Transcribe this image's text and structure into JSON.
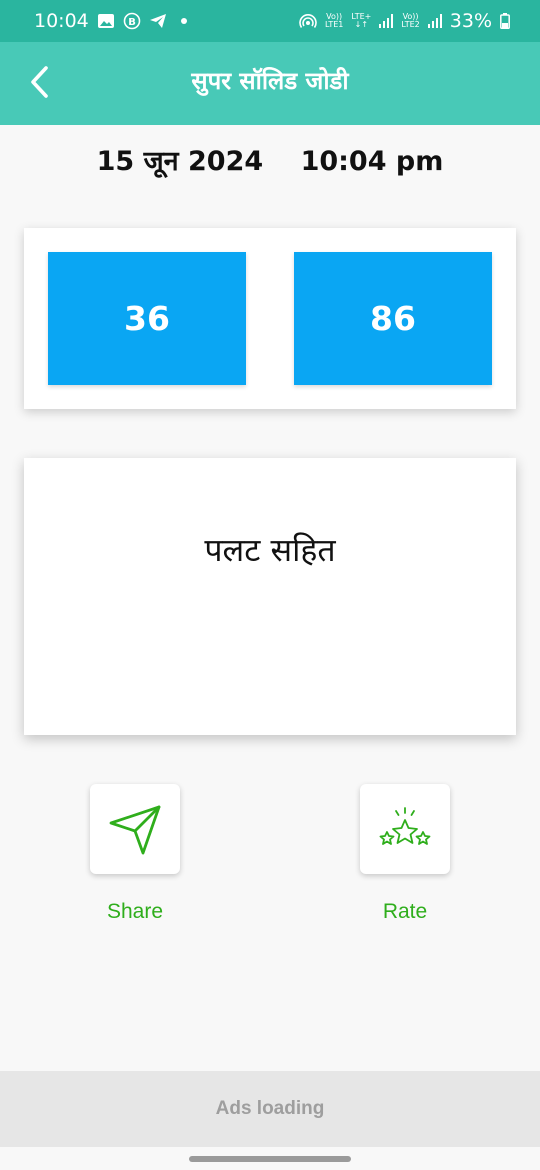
{
  "status_bar": {
    "time": "10:04",
    "left_icons": [
      "image-icon",
      "b-badge-icon",
      "telegram-icon",
      "dot-icon"
    ],
    "sim1_label": "LTE1",
    "sim2_label": "LTE2",
    "lte_plus": "LTE+",
    "volte": "Vo))",
    "battery": "33%"
  },
  "app_bar": {
    "title": "सुपर सॉलिड जोडी",
    "back_icon": "chevron-left-icon"
  },
  "datetime": {
    "date": "15 जून 2024",
    "time": "10:04 pm"
  },
  "numbers": {
    "left": "36",
    "right": "86",
    "box_color": "#0aa6f3"
  },
  "message": {
    "text": "पलट सहित"
  },
  "actions": {
    "share_label": "Share",
    "share_icon": "send-icon",
    "rate_label": "Rate",
    "rate_icon": "stars-icon",
    "accent_color": "#2fae1c"
  },
  "ad_bar": {
    "text": "Ads loading"
  },
  "colors": {
    "status_bar": "#2ab59f",
    "app_bar": "#48c9b7"
  }
}
